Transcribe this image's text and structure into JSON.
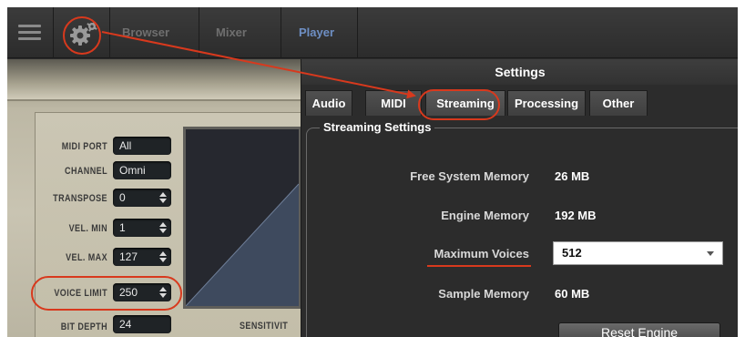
{
  "toolbar": {
    "menu_icon": "hamburger-menu-icon",
    "settings_icon": "gear-icon",
    "tabs": [
      {
        "label": "Browser",
        "active": false
      },
      {
        "label": "Mixer",
        "active": false
      },
      {
        "label": "Player",
        "active": true
      }
    ]
  },
  "instrument": {
    "params": [
      {
        "label": "MIDI PORT",
        "value": "All",
        "spinner": false
      },
      {
        "label": "CHANNEL",
        "value": "Omni",
        "spinner": false
      },
      {
        "label": "TRANSPOSE",
        "value": "0",
        "spinner": true
      },
      {
        "label": "VEL. MIN",
        "value": "1",
        "spinner": true
      },
      {
        "label": "VEL. MAX",
        "value": "127",
        "spinner": true
      },
      {
        "label": "VOICE LIMIT",
        "value": "250",
        "spinner": true
      },
      {
        "label": "BIT DEPTH",
        "value": "24",
        "spinner": false
      }
    ],
    "sensitivity_label": "SENSITIVIT"
  },
  "settings": {
    "title": "Settings",
    "tabs": [
      {
        "label": "Audio",
        "active": false
      },
      {
        "label": "MIDI",
        "active": false
      },
      {
        "label": "Streaming",
        "active": true
      },
      {
        "label": "Processing",
        "active": false
      },
      {
        "label": "Other",
        "active": false
      }
    ],
    "group_title": "Streaming Settings",
    "free_memory": {
      "label": "Free System Memory",
      "value": "26 MB"
    },
    "engine_memory": {
      "label": "Engine Memory",
      "value": "192 MB"
    },
    "max_voices": {
      "label": "Maximum Voices",
      "value": "512"
    },
    "sample_memory": {
      "label": "Sample Memory",
      "value": "60 MB"
    },
    "reset_button": "Reset Engine"
  },
  "colors": {
    "annotation": "#d8391d",
    "active_tab": "#6e8fc4",
    "panel": "#c9c4b2"
  }
}
